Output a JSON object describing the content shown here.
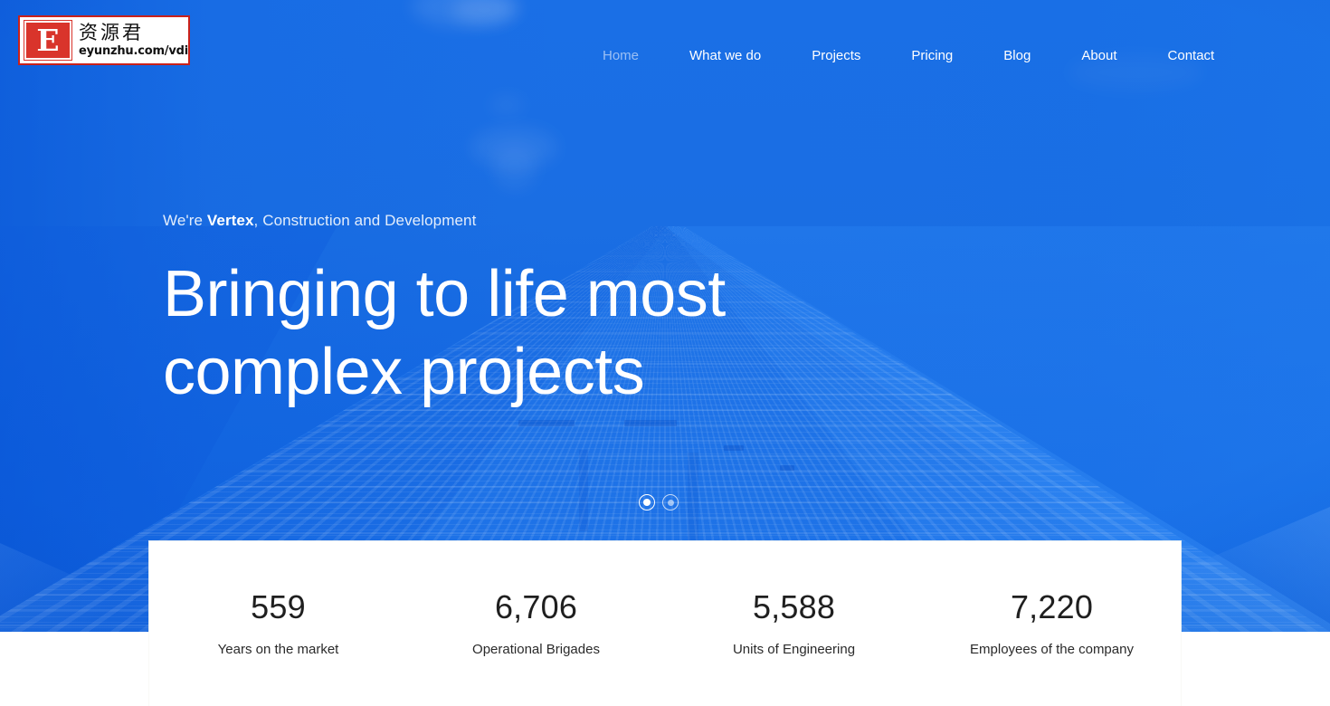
{
  "site": {
    "brand": "Vertex",
    "brand_visible_fragment": "tex"
  },
  "header": {
    "nav": [
      {
        "label": "Home",
        "state": "active"
      },
      {
        "label": "What we do",
        "state": "default"
      },
      {
        "label": "Projects",
        "state": "default"
      },
      {
        "label": "Pricing",
        "state": "default"
      },
      {
        "label": "Blog",
        "state": "default"
      },
      {
        "label": "About",
        "state": "default"
      },
      {
        "label": "Contact",
        "state": "default"
      }
    ]
  },
  "hero": {
    "eyebrow_prefix": "We're ",
    "eyebrow_brand": "Vertex",
    "eyebrow_suffix": ", Construction and Development",
    "headline": "Bringing to life most\ncomplex projects",
    "carousel": {
      "slides": [
        "1",
        "2"
      ],
      "active_index": 0
    }
  },
  "stats": [
    {
      "value": "559",
      "label": "Years on the market"
    },
    {
      "value": "6,706",
      "label": "Operational Brigades"
    },
    {
      "value": "5,588",
      "label": "Units of Engineering"
    },
    {
      "value": "7,220",
      "label": "Employees of the company"
    }
  ],
  "watermark": {
    "badge_letter": "E",
    "cn_text": "资源君",
    "url": "eyunzhu.com/vdisk"
  },
  "colors": {
    "hero_blue": "#1a6ee3",
    "hero_blue_dark": "#0c5fdd",
    "card_bg": "#ffffff",
    "text_dark": "#1f1f1f",
    "nav_active": "rgba(255,255,255,0.56)",
    "watermark_red": "#d9342b"
  }
}
